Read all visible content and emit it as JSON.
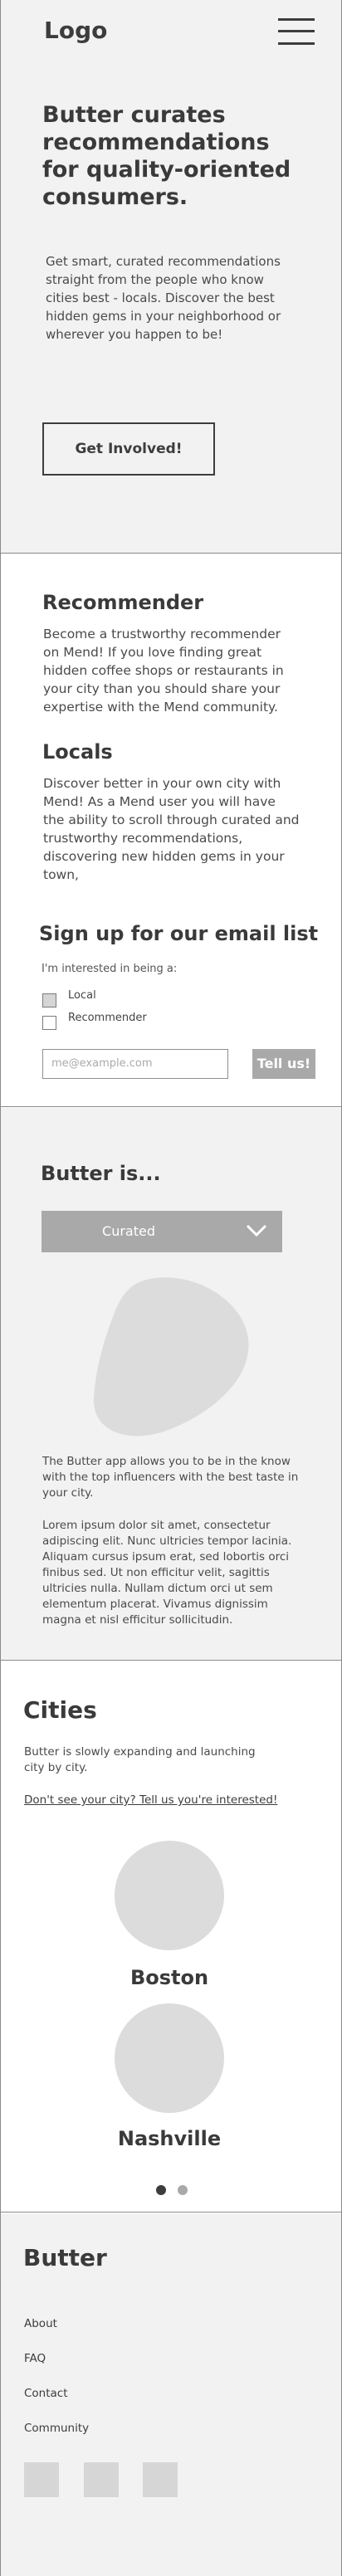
{
  "header": {
    "logo": "Logo",
    "menu_icon": "hamburger-menu-icon"
  },
  "hero": {
    "title": "Butter curates recommendations for quality-oriented consumers.",
    "body": "Get smart, curated recommendations straight from the people who know cities best - locals. Discover the best hidden gems in your neighborhood or wherever you happen to be!",
    "cta_label": "Get Involved!"
  },
  "roles": {
    "recommender": {
      "title": "Recommender",
      "body": "Become a trustworthy recommender on Mend! If you love finding great hidden coffee shops or restaurants in your city than you should share your expertise with the Mend community."
    },
    "locals": {
      "title": "Locals",
      "body": "Discover better in your own city with Mend! As a Mend user you will have the ability to scroll through curated and trustworthy recommendations, discovering new hidden gems in your town,"
    }
  },
  "signup": {
    "title": "Sign up for our email list",
    "subtitle": "I'm interested in being a:",
    "options": [
      {
        "label": "Local",
        "checked": true
      },
      {
        "label": "Recommender",
        "checked": false
      }
    ],
    "email_placeholder": "me@example.com",
    "submit_label": "Tell us!"
  },
  "butter_is": {
    "title": "Butter is...",
    "dropdown_value": "Curated",
    "dropdown_icon": "chevron-down-icon",
    "paragraph1": "The Butter app allows you to be in the know with the top influencers with the best taste in your city.",
    "paragraph2": "Lorem ipsum dolor sit amet, consectetur adipiscing elit. Nunc ultricies tempor lacinia. Aliquam cursus ipsum erat, sed lobortis orci finibus sed. Ut non efficitur velit, sagittis ultricies nulla. Nullam dictum orci ut sem elementum placerat. Vivamus dignissim magna et nisl efficitur sollicitudin."
  },
  "cities": {
    "title": "Cities",
    "body": "Butter is slowly expanding and launching city by city.",
    "link": "Don't see your city? Tell us you're interested!",
    "items": [
      {
        "name": "Boston"
      },
      {
        "name": "Nashville"
      }
    ],
    "carousel_dots": 2,
    "active_dot": 0,
    "colors": {
      "dot_active": "#3d3d3d",
      "dot_inactive": "#a9a9a9"
    }
  },
  "footer": {
    "title": "Butter",
    "links": [
      "About",
      "FAQ",
      "Contact",
      "Community"
    ],
    "social_icons": [
      "social-icon-1",
      "social-icon-2",
      "social-icon-3"
    ]
  },
  "colors": {
    "section_gray": "#f2f2f2",
    "button_gray": "#a9a9a9",
    "text_dark": "#3d3d3d",
    "placeholder_gray": "#dcdcdc"
  }
}
